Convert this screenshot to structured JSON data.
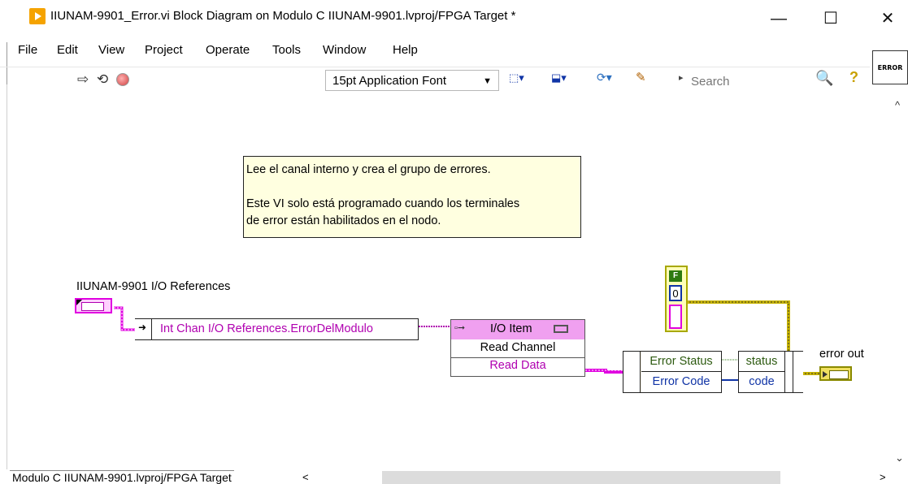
{
  "window": {
    "title": "IIUNAM-9901_Error.vi Block Diagram on Modulo C IIUNAM-9901.lvproj/FPGA Target *",
    "minimize": "—",
    "maximize": "☐",
    "close": "✕"
  },
  "menu": [
    "File",
    "Edit",
    "View",
    "Project",
    "Operate",
    "Tools",
    "Window",
    "Help"
  ],
  "toolbar": {
    "font": "15pt Application Font",
    "search_placeholder": "Search",
    "error_icon_text": "ERROR"
  },
  "diagram": {
    "comment": [
      "Lee el canal interno y crea el grupo de errores.",
      "",
      "Este VI solo está programado cuando los terminales",
      "de error están habilitados en el nodo."
    ],
    "io_references_label": "IIUNAM-9901 I/O References",
    "int_chan_text": "Int Chan I/O References.ErrorDelModulo",
    "io_node": {
      "title": "I/O Item",
      "method": "Read Channel",
      "output": "Read Data"
    },
    "unbundle": {
      "status": "Error Status",
      "code": "Error Code"
    },
    "bundle": {
      "status": "status",
      "code": "code"
    },
    "constant": {
      "bool": "F",
      "num": "0"
    },
    "error_out_label": "error out"
  },
  "statusbar": {
    "target": "Modulo C IIUNAM-9901.lvproj/FPGA Target"
  },
  "colors": {
    "refnum_wire": "#e000e0",
    "error_wire": "#c8b400",
    "numeric_wire": "#1034a6",
    "comment_bg": "#ffffe0"
  }
}
